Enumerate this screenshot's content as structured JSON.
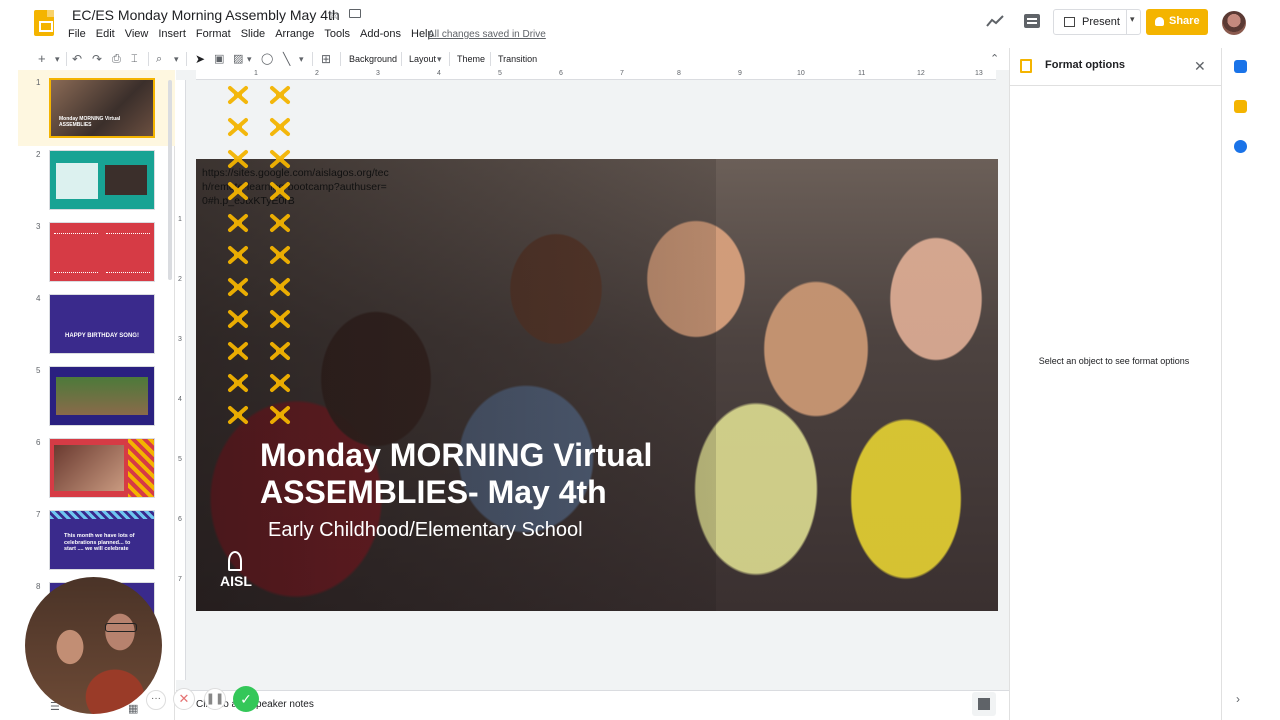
{
  "app": {
    "doc_title": "EC/ES Monday Morning Assembly May 4th",
    "saved_status": "All changes saved in Drive",
    "menu": [
      "File",
      "Edit",
      "View",
      "Insert",
      "Format",
      "Slide",
      "Arrange",
      "Tools",
      "Add-ons",
      "Help"
    ],
    "present_label": "Present",
    "share_label": "Share",
    "accent_color": "#f4b400"
  },
  "toolbar": {
    "background_label": "Background",
    "layout_label": "Layout",
    "theme_label": "Theme",
    "transition_label": "Transition"
  },
  "filmstrip": {
    "slides": [
      {
        "num": "1",
        "caption": "Monday MORNING Virtual ASSEMBLIES",
        "color": "#3b2f2b"
      },
      {
        "num": "2",
        "caption": "",
        "color": "#18a394"
      },
      {
        "num": "3",
        "caption": "",
        "color": "#d63b45"
      },
      {
        "num": "4",
        "caption": "HAPPY BIRTHDAY SONG!",
        "color": "#3a2a8c"
      },
      {
        "num": "5",
        "caption": "",
        "color": "#2a2080"
      },
      {
        "num": "6",
        "caption": "",
        "color": "#d63b45"
      },
      {
        "num": "7",
        "caption": "This month we have lots of celebrations planned... to start .... we will celebrate",
        "color": "#3a2a8c"
      },
      {
        "num": "8",
        "caption": "",
        "color": "#3a2a8c"
      }
    ]
  },
  "slide": {
    "url_text": "https://sites.google.com/aislagos.org/tech/remote-learning-bootcamp?authuser=0#h.p_eJtxKTyE0rB",
    "title_line1": "Monday MORNING Virtual",
    "title_line2": "ASSEMBLIES- May 4th",
    "subtitle": "Early Childhood/Elementary School",
    "logo_text": "AISL"
  },
  "notes": {
    "placeholder": "Click to add speaker notes"
  },
  "format_panel": {
    "title": "Format options",
    "message": "Select an object to see format options"
  },
  "ruler": {
    "top_marks": [
      "1",
      "2",
      "3",
      "4",
      "5",
      "6",
      "7",
      "8",
      "9",
      "10",
      "11",
      "12",
      "13"
    ],
    "left_marks": [
      "1",
      "2",
      "3",
      "4",
      "5",
      "6",
      "7"
    ]
  }
}
